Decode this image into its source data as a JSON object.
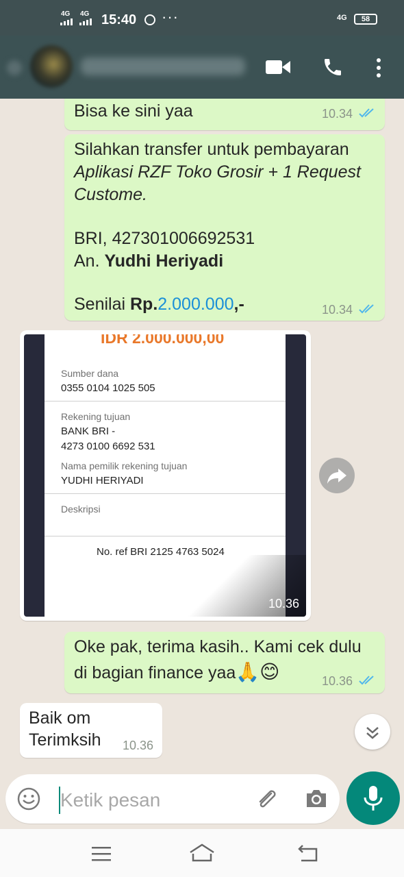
{
  "status_bar": {
    "network_1": "4G",
    "network_2": "4G",
    "time": "15:40",
    "more": "···",
    "network_right": "4G",
    "battery": "58"
  },
  "colors": {
    "header": "#3c5254",
    "outgoing_bubble": "#dcf8c6",
    "incoming_bubble": "#ffffff",
    "read_ticks": "#4fb6ec",
    "accent": "#04887a"
  },
  "messages": {
    "m1": {
      "text": "Bisa ke sini yaa",
      "time": "10.34"
    },
    "m2": {
      "line1": "Silahkan transfer untuk pembayaran",
      "line2": "Aplikasi RZF Toko Grosir + 1 Request",
      "line3": "Custome.",
      "line4": "BRI, 427301006692531",
      "an_label": "An. ",
      "an_name": "Yudhi Heriyadi",
      "senilai_label": "Senilai ",
      "rp_label": "Rp.",
      "amount": "2.000.000",
      "suffix": ",-",
      "time": "10.34"
    },
    "image": {
      "amount": "IDR 2.000.000,00",
      "sumber_label": "Sumber dana",
      "sumber_value": "0355 0104 1025 505",
      "rekening_label": "Rekening tujuan",
      "bank": "BANK BRI -",
      "rekening_value": "4273 0100 6692 531",
      "nama_label": "Nama pemilik rekening tujuan",
      "nama_value": "YUDHI HERIYADI",
      "deskripsi_label": "Deskripsi",
      "ref": "No. ref BRI 2125 4763 5024",
      "time": "10.36"
    },
    "m3": {
      "line1": "Oke pak, terima kasih.. Kami cek dulu",
      "line2": "di bagian finance yaa",
      "emoji": "🙏😊",
      "time": "10.36"
    },
    "m4": {
      "line1": "Baik om",
      "line2": "Terimksih",
      "time": "10.36"
    }
  },
  "input": {
    "placeholder": "Ketik pesan"
  }
}
